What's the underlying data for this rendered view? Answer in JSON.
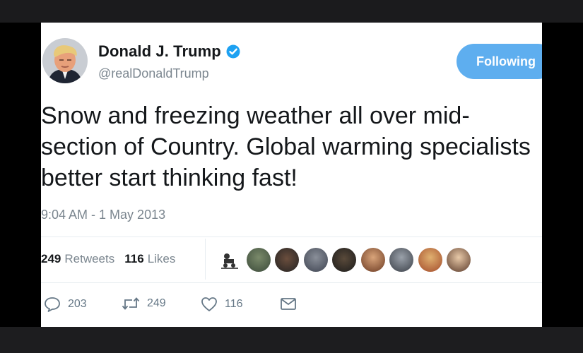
{
  "tweet": {
    "display_name": "Donald J. Trump",
    "handle": "@realDonaldTrump",
    "follow_button_label": "Following",
    "text": "Snow and freezing weather all over mid-section of Country. Global warming specialists better start thinking fast!",
    "timestamp": "9:04 AM - 1 May 2013"
  },
  "stats": {
    "retweets_count": "249",
    "retweets_label": "Retweets",
    "likes_count": "116",
    "likes_label": "Likes"
  },
  "actions": {
    "reply_count": "203",
    "retweet_count": "249",
    "like_count": "116"
  },
  "colors": {
    "verified_blue": "#1da1f2",
    "follow_button": "#5eaeef",
    "secondary_text": "#7b868f"
  },
  "icons": {
    "verified": "verified-badge-icon",
    "reply": "reply-icon",
    "retweet": "retweet-icon",
    "like": "heart-icon",
    "message": "envelope-icon"
  }
}
